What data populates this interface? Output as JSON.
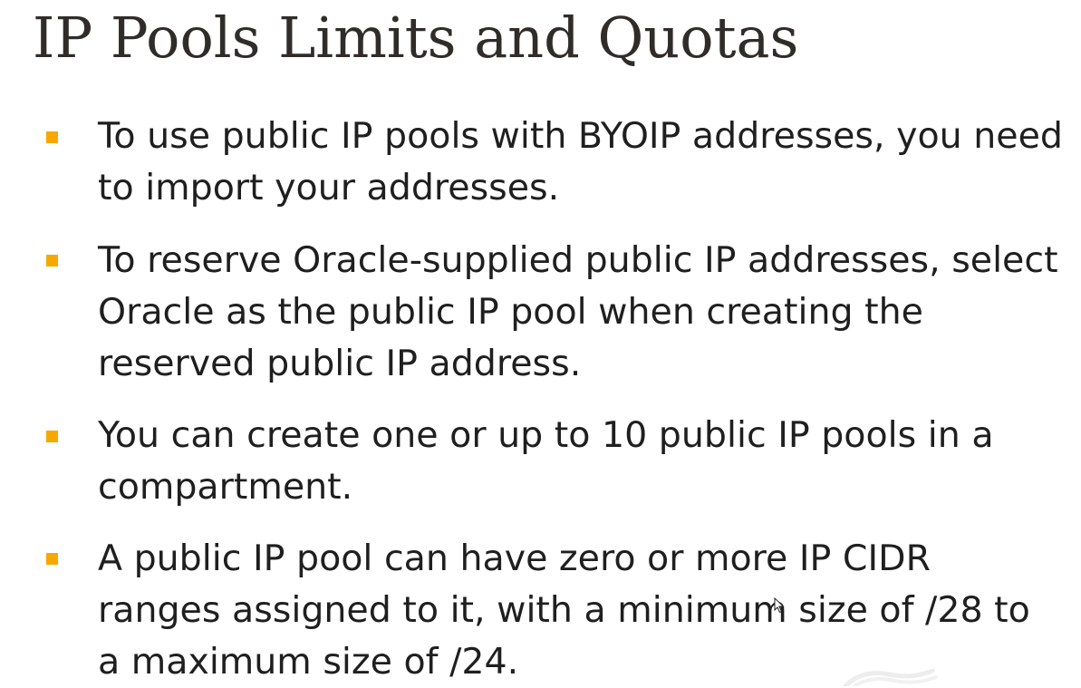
{
  "slide": {
    "title": "IP Pools Limits and Quotas",
    "accent_color": "#f7a800",
    "bullets": [
      "To use public IP pools with BYOIP addresses, you need to import your addresses.",
      "To reserve Oracle-supplied public IP addresses, select Oracle as the public IP pool when creating the reserved public IP address.",
      "You can create one or up to 10 public IP pools in a compartment.",
      "A public IP pool can have zero or more IP CIDR ranges assigned to it, with a minimum size of /28 to a maximum size of /24."
    ]
  },
  "icons": {
    "bullet_marker": "square-bullet-icon",
    "mouse_cursor": "mouse-pointer-icon",
    "watermark": "wave-watermark-icon"
  }
}
